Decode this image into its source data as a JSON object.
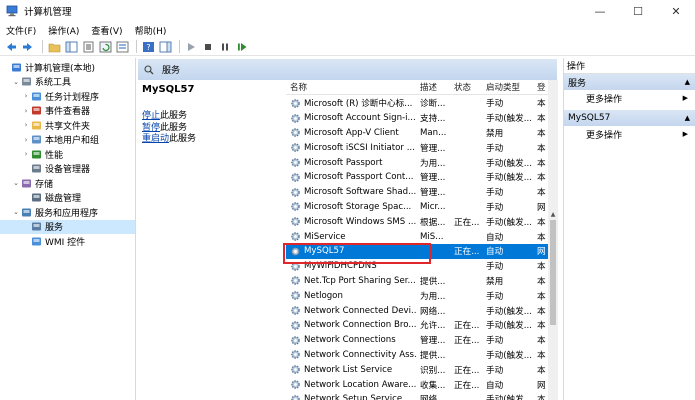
{
  "window": {
    "title": "计算机管理",
    "controls": {
      "minimize": "—",
      "maximize": "☐",
      "close": "✕"
    }
  },
  "menu": [
    "文件(F)",
    "操作(A)",
    "查看(V)",
    "帮助(H)"
  ],
  "tree": [
    {
      "label": "计算机管理(本地)",
      "level": 0,
      "arrow": "",
      "icon": "computer-icon"
    },
    {
      "label": "系统工具",
      "level": 1,
      "arrow": "⌄",
      "icon": "tools-icon"
    },
    {
      "label": "任务计划程序",
      "level": 2,
      "arrow": "›",
      "icon": "clock-icon"
    },
    {
      "label": "事件查看器",
      "level": 2,
      "arrow": "›",
      "icon": "event-icon"
    },
    {
      "label": "共享文件夹",
      "level": 2,
      "arrow": "›",
      "icon": "folder-icon"
    },
    {
      "label": "本地用户和组",
      "level": 2,
      "arrow": "›",
      "icon": "users-icon"
    },
    {
      "label": "性能",
      "level": 2,
      "arrow": "›",
      "icon": "perf-icon"
    },
    {
      "label": "设备管理器",
      "level": 2,
      "arrow": "",
      "icon": "device-icon"
    },
    {
      "label": "存储",
      "level": 1,
      "arrow": "⌄",
      "icon": "storage-icon"
    },
    {
      "label": "磁盘管理",
      "level": 2,
      "arrow": "",
      "icon": "disk-icon"
    },
    {
      "label": "服务和应用程序",
      "level": 1,
      "arrow": "⌄",
      "icon": "apps-icon"
    },
    {
      "label": "服务",
      "level": 2,
      "arrow": "",
      "icon": "gear-icon",
      "selected": true
    },
    {
      "label": "WMI 控件",
      "level": 2,
      "arrow": "",
      "icon": "wmi-icon"
    }
  ],
  "panel": {
    "header": "服务"
  },
  "description": {
    "service_name": "MySQL57",
    "links": [
      {
        "action": "停止",
        "rest": "此服务"
      },
      {
        "action": "暂停",
        "rest": "此服务"
      },
      {
        "action": "重启动",
        "rest": "此服务"
      }
    ]
  },
  "list": {
    "columns": {
      "name": "名称",
      "desc": "描述",
      "status": "状态",
      "startup": "启动类型",
      "logon": "登"
    },
    "rows": [
      {
        "name": "Microsoft (R) 诊断中心标...",
        "desc": "诊断...",
        "status": "",
        "startup": "手动",
        "logon": "本"
      },
      {
        "name": "Microsoft Account Sign-i...",
        "desc": "支持...",
        "status": "",
        "startup": "手动(触发...",
        "logon": "本"
      },
      {
        "name": "Microsoft App-V Client",
        "desc": "Man...",
        "status": "",
        "startup": "禁用",
        "logon": "本"
      },
      {
        "name": "Microsoft iSCSI Initiator ...",
        "desc": "管理...",
        "status": "",
        "startup": "手动",
        "logon": "本"
      },
      {
        "name": "Microsoft Passport",
        "desc": "为用...",
        "status": "",
        "startup": "手动(触发...",
        "logon": "本"
      },
      {
        "name": "Microsoft Passport Cont...",
        "desc": "管理...",
        "status": "",
        "startup": "手动(触发...",
        "logon": "本"
      },
      {
        "name": "Microsoft Software Shad...",
        "desc": "管理...",
        "status": "",
        "startup": "手动",
        "logon": "本"
      },
      {
        "name": "Microsoft Storage Spac...",
        "desc": "Micr...",
        "status": "",
        "startup": "手动",
        "logon": "网"
      },
      {
        "name": "Microsoft Windows SMS ...",
        "desc": "根据...",
        "status": "正在...",
        "startup": "手动(触发...",
        "logon": "本"
      },
      {
        "name": "MiService",
        "desc": "MiS...",
        "status": "",
        "startup": "自动",
        "logon": "本"
      },
      {
        "name": "MySQL57",
        "desc": "",
        "status": "正在...",
        "startup": "自动",
        "logon": "网",
        "selected": true
      },
      {
        "name": "MyWiFiDHCPDNS",
        "desc": "",
        "status": "",
        "startup": "手动",
        "logon": "本"
      },
      {
        "name": "Net.Tcp Port Sharing Ser...",
        "desc": "提供...",
        "status": "",
        "startup": "禁用",
        "logon": "本"
      },
      {
        "name": "Netlogon",
        "desc": "为用...",
        "status": "",
        "startup": "手动",
        "logon": "本"
      },
      {
        "name": "Network Connected Devi...",
        "desc": "网络...",
        "status": "",
        "startup": "手动(触发...",
        "logon": "本"
      },
      {
        "name": "Network Connection Bro...",
        "desc": "允许...",
        "status": "正在...",
        "startup": "手动(触发...",
        "logon": "本"
      },
      {
        "name": "Network Connections",
        "desc": "管理...",
        "status": "正在...",
        "startup": "手动",
        "logon": "本"
      },
      {
        "name": "Network Connectivity Ass...",
        "desc": "提供...",
        "status": "",
        "startup": "手动(触发...",
        "logon": "本"
      },
      {
        "name": "Network List Service",
        "desc": "识别...",
        "status": "正在...",
        "startup": "手动",
        "logon": "本"
      },
      {
        "name": "Network Location Aware...",
        "desc": "收集...",
        "status": "正在...",
        "startup": "自动",
        "logon": "网"
      },
      {
        "name": "Network Setup Service",
        "desc": "网络...",
        "status": "",
        "startup": "手动(触发...",
        "logon": "本"
      }
    ]
  },
  "actions": {
    "title": "操作",
    "sections": [
      {
        "label": "服务",
        "item": "更多操作"
      },
      {
        "label": "MySQL57",
        "item": "更多操作"
      }
    ]
  },
  "colors": {
    "selection": "#0078d7",
    "header_gradient": "#d9e6f5",
    "highlight_border": "#e0262a",
    "link": "#0645ad"
  }
}
